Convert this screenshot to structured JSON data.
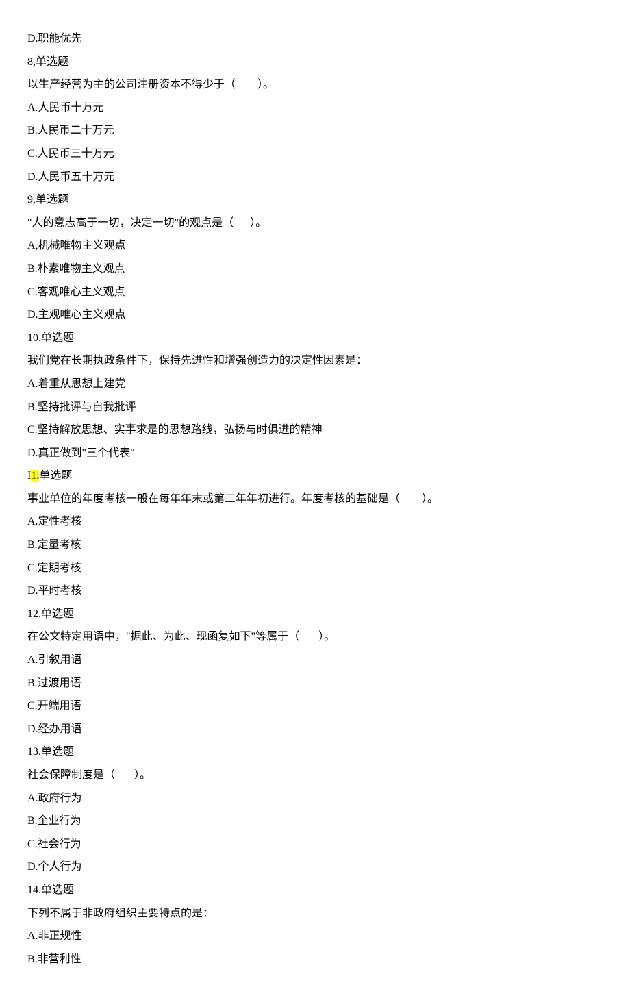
{
  "lines": [
    {
      "text": "D.职能优先"
    },
    {
      "text": "8,单选题"
    },
    {
      "text": "以生产经营为主的公司注册资本不得少于（        ）。"
    },
    {
      "text": "A.人民币十万元"
    },
    {
      "text": "B.人民币二十万元"
    },
    {
      "text": "C.人民币三十万元"
    },
    {
      "text": "D.人民币五十万元"
    },
    {
      "text": "9,单选题"
    },
    {
      "text": "\"人的意志高于一切，决定一切\"的观点是（      ）。"
    },
    {
      "text": "A,机械唯物主义观点"
    },
    {
      "text": "B.朴素唯物主义观点"
    },
    {
      "text": "C.客观唯心主义观点"
    },
    {
      "text": "D.主观唯心主义观点"
    },
    {
      "text": "10.单选题"
    },
    {
      "text": "我们党在长期执政条件下，保持先进性和增强创造力的决定性因素是："
    },
    {
      "text": "A.着重从思想上建党"
    },
    {
      "text": "B.坚持批评与自我批评"
    },
    {
      "text": "C.坚持解放思想、实事求是的思想路线，弘扬与时俱进的精神"
    },
    {
      "text": "D.真正做到\"三个代表\""
    },
    {
      "prefix": "I",
      "highlight": "1.",
      "suffix": "单选题"
    },
    {
      "text": "事业单位的年度考核一般在每年年末或第二年年初进行。年度考核的基础是（        ）。"
    },
    {
      "text": "A.定性考核"
    },
    {
      "text": "B.定量考核"
    },
    {
      "text": "C.定期考核"
    },
    {
      "text": "D.平时考核"
    },
    {
      "text": "12.单选题"
    },
    {
      "text": "在公文特定用语中，\"据此、为此、现函复如下\"等属于（       ）。"
    },
    {
      "text": "A.引叙用语"
    },
    {
      "text": "B.过渡用语"
    },
    {
      "text": "C.开端用语"
    },
    {
      "text": "D.经办用语"
    },
    {
      "text": "13.单选题"
    },
    {
      "text": "社会保障制度是（       ）。"
    },
    {
      "text": "A.政府行为"
    },
    {
      "text": "B.企业行为"
    },
    {
      "text": "C.社会行为"
    },
    {
      "text": "D.个人行为"
    },
    {
      "text": "14.单选题"
    },
    {
      "text": "下列不属于非政府组织主要特点的是："
    },
    {
      "text": "A.非正规性"
    },
    {
      "text": "B.非营利性"
    }
  ]
}
